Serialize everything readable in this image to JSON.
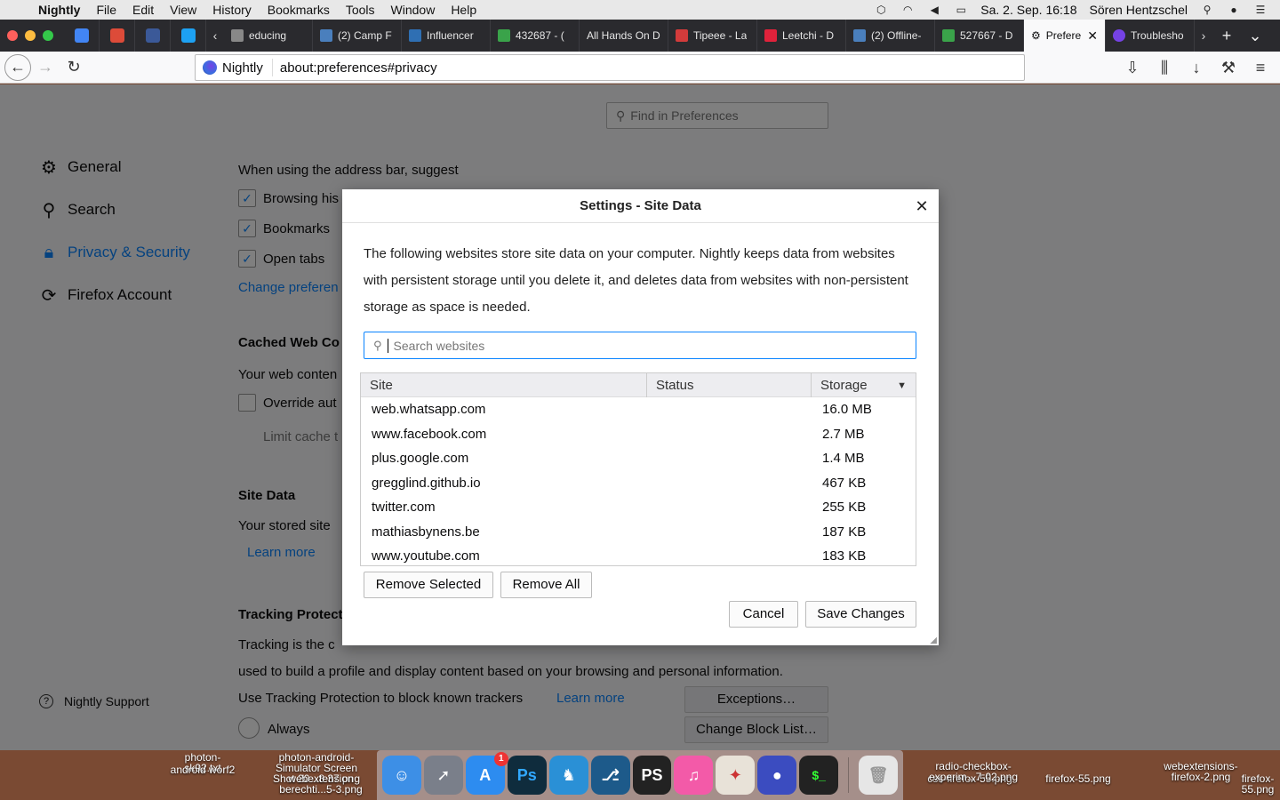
{
  "menubar": {
    "app_name": "Nightly",
    "items": [
      "File",
      "Edit",
      "View",
      "History",
      "Bookmarks",
      "Tools",
      "Window",
      "Help"
    ],
    "datetime": "Sa. 2. Sep.  16:18",
    "user": "Sören Hentzschel"
  },
  "tabs": [
    {
      "label": "educing",
      "color": "#888"
    },
    {
      "label": "(2) Camp F",
      "color": "#4a7fbd"
    },
    {
      "label": "Influencer",
      "color": "#2f6fb3"
    },
    {
      "label": "432687 - (",
      "color": "#3aa34a"
    },
    {
      "label": "All Hands On D",
      "color": "#555"
    },
    {
      "label": "Tipeee - La",
      "color": "#d33b3b"
    },
    {
      "label": "Leetchi - D",
      "color": "#e0223b"
    },
    {
      "label": "(2) Offline-",
      "color": "#4a7fbd"
    },
    {
      "label": "527667 - D",
      "color": "#3aa34a"
    },
    {
      "label": "Prefere",
      "color": "#444"
    },
    {
      "label": "Troublesho",
      "color": "#7542e5"
    }
  ],
  "pinned": [
    {
      "icon": "docs-icon",
      "color": "#4285f4"
    },
    {
      "icon": "gplus-icon",
      "color": "#dd4b39"
    },
    {
      "icon": "facebook-icon",
      "color": "#3b5998"
    },
    {
      "icon": "twitter-icon",
      "color": "#1da1f2"
    }
  ],
  "navbar": {
    "identity": "Nightly",
    "url": "about:preferences#privacy"
  },
  "prefs": {
    "find_placeholder": "Find in Preferences",
    "categories": [
      "General",
      "Search",
      "Privacy & Security",
      "Firefox Account"
    ],
    "support": "Nightly Support",
    "address_bar_heading": "When using the address bar, suggest",
    "cb_browsing": "Browsing his",
    "cb_bookmarks": "Bookmarks",
    "cb_tabs": "Open tabs",
    "change_prefs": "Change preferen",
    "cached_heading": "Cached Web Co",
    "cached_text": "Your web conten",
    "override": "Override aut",
    "limit": "Limit cache t",
    "sitedata_heading": "Site Data",
    "sitedata_text": "Your stored site",
    "learn_more": "Learn more",
    "tracking_heading": "Tracking Protect",
    "tracking_line1": "Tracking is the c",
    "tracking_line2": "used to build a profile and display content based on your browsing and personal information.",
    "tracking_line3": "Use Tracking Protection to block known trackers",
    "learn_more2": "Learn more",
    "exceptions": "Exceptions…",
    "change_block": "Change Block List…",
    "always": "Always"
  },
  "dialog": {
    "title": "Settings - Site Data",
    "description": "The following websites store site data on your computer. Nightly keeps data from websites with persistent storage until you delete it, and deletes data from websites with non-persistent storage as space is needed.",
    "search_placeholder": "Search websites",
    "columns": {
      "site": "Site",
      "status": "Status",
      "storage": "Storage"
    },
    "rows": [
      {
        "site": "web.whatsapp.com",
        "status": "",
        "storage": "16.0 MB"
      },
      {
        "site": "www.facebook.com",
        "status": "",
        "storage": "2.7 MB"
      },
      {
        "site": "plus.google.com",
        "status": "",
        "storage": "1.4 MB"
      },
      {
        "site": "gregglind.github.io",
        "status": "",
        "storage": "467 KB"
      },
      {
        "site": "twitter.com",
        "status": "",
        "storage": "255 KB"
      },
      {
        "site": "mathiasbynens.be",
        "status": "",
        "storage": "187 KB"
      },
      {
        "site": "www.youtube.com",
        "status": "",
        "storage": "183 KB"
      }
    ],
    "remove_selected": "Remove Selected",
    "remove_all": "Remove All",
    "cancel": "Cancel",
    "save": "Save Changes"
  },
  "desktop_labels": [
    {
      "text": "photon-\nsk92.txt"
    },
    {
      "text": "android\nworf2"
    },
    {
      "text": "photon-android-\nSimulator Screen\nShot 20...8.37.png"
    },
    {
      "text": "webextension\nberechti...5-3.png"
    },
    {
      "text": "css-firefox-55.png"
    },
    {
      "text": "radio-checkbox-\nexperim...7-02.png"
    },
    {
      "text": "firefox-55.png"
    },
    {
      "text": "webextensions-\nfirefox-2.png"
    },
    {
      "text": "firefox-55.png"
    }
  ],
  "dock": [
    {
      "icon": "finder-icon",
      "color": "#3d8fe6",
      "text": ""
    },
    {
      "icon": "launchpad-icon",
      "color": "#7a7f8a",
      "text": ""
    },
    {
      "icon": "appstore-icon",
      "color": "#2d8cf0",
      "text": "A",
      "badge": "1"
    },
    {
      "icon": "photoshop-icon",
      "color": "#0f2c3d",
      "text": "Ps"
    },
    {
      "icon": "mastodon-icon",
      "color": "#2a90d6",
      "text": ""
    },
    {
      "icon": "sourcetree-icon",
      "color": "#1d5a8a",
      "text": ""
    },
    {
      "icon": "phpstorm-icon",
      "color": "#222",
      "text": "PS"
    },
    {
      "icon": "itunes-icon",
      "color": "#f35aa8",
      "text": "♫"
    },
    {
      "icon": "compass-icon",
      "color": "#e8e2d8",
      "text": ""
    },
    {
      "icon": "nightly-icon",
      "color": "#3b4cc0",
      "text": ""
    },
    {
      "icon": "terminal-icon",
      "color": "#222",
      "text": "$_"
    },
    {
      "icon": "trash-icon",
      "color": "#e6e6e6",
      "text": ""
    }
  ]
}
